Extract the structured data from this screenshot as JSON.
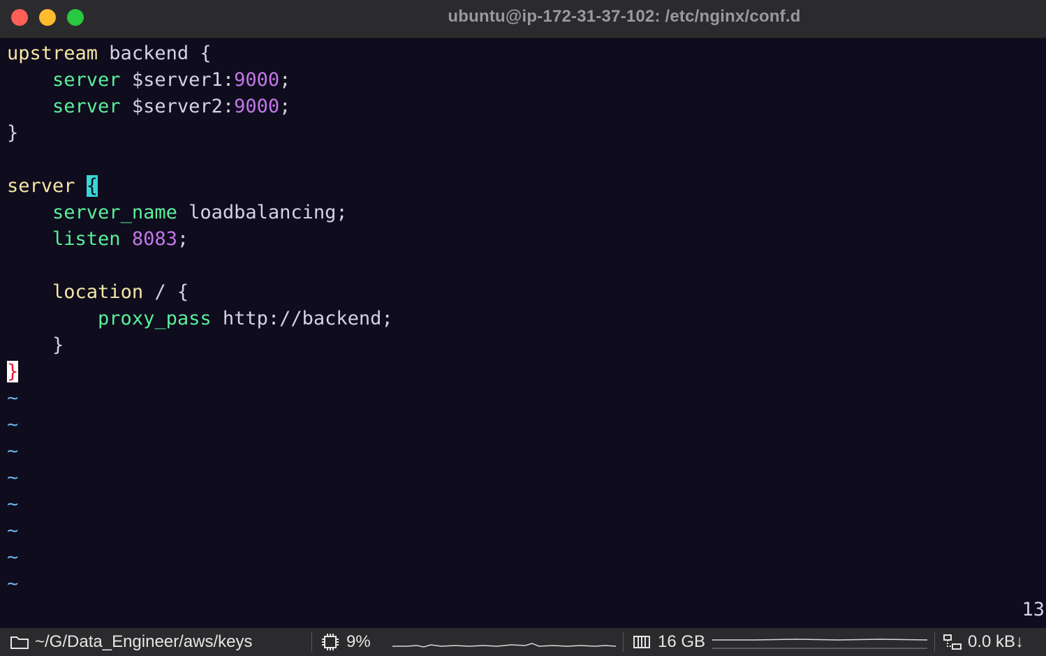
{
  "window": {
    "title": "ubuntu@ip-172-31-37-102: /etc/nginx/conf.d"
  },
  "editor": {
    "l1": {
      "kw": "upstream",
      "rest": " backend {"
    },
    "l2": {
      "indent": "    ",
      "kw": "server",
      "var": " $server1:",
      "num": "9000",
      "end": ";"
    },
    "l3": {
      "indent": "    ",
      "kw": "server",
      "var": " $server2:",
      "num": "9000",
      "end": ";"
    },
    "l4": {
      "text": "}"
    },
    "l6": {
      "kw": "server",
      "sp": " ",
      "brace": "{"
    },
    "l7": {
      "indent": "    ",
      "kw": "server_name",
      "rest": " loadbalancing;"
    },
    "l8": {
      "indent": "    ",
      "kw": "listen",
      "sp": " ",
      "num": "8083",
      "end": ";"
    },
    "l10": {
      "indent": "    ",
      "kw": "location",
      "rest": " / {"
    },
    "l11": {
      "indent": "        ",
      "kw": "proxy_pass",
      "rest": " http://backend;"
    },
    "l12": {
      "text": "    }"
    },
    "l13": {
      "brace": "}"
    },
    "tilde": "~",
    "line_number": "13"
  },
  "statusbar": {
    "path": "~/G/Data_Engineer/aws/keys",
    "cpu": "9%",
    "memory": "16 GB",
    "network": "0.0 kB↓"
  },
  "colors": {
    "background": "#0f0c1e",
    "keyword_yellow": "#f5e6a6",
    "keyword_green": "#5af09a",
    "number": "#c278e8",
    "cursor": "#38d6d6",
    "tilde": "#6bb3e8"
  }
}
